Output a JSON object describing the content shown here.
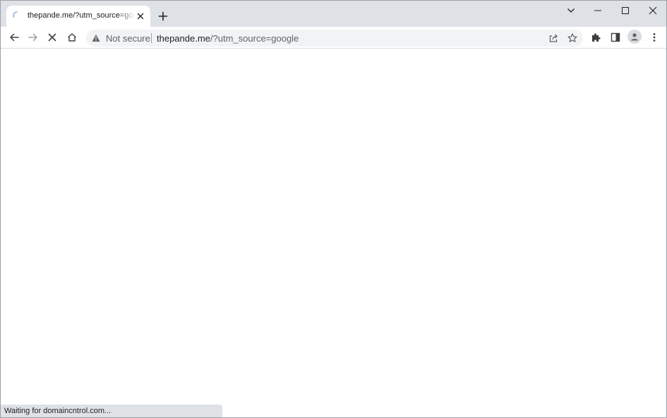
{
  "tab": {
    "title": "thepande.me/?utm_source=google",
    "close_icon": "close-icon",
    "favicon": "loading-spinner-icon"
  },
  "tabstrip": {
    "new_tab_icon": "plus-icon",
    "tab_search_icon": "chevron-down-icon"
  },
  "window_controls": [
    "minimize-icon",
    "maximize-icon",
    "close-icon"
  ],
  "toolbar": {
    "back_icon": "arrow-left-icon",
    "forward_icon": "arrow-right-icon",
    "stop_icon": "stop-x-icon",
    "home_icon": "home-icon"
  },
  "omnibox": {
    "security_label": "Not secure",
    "security_icon": "warning-triangle-icon",
    "url_host": "thepande.me",
    "url_path": "/?utm_source=google",
    "share_icon": "share-icon",
    "bookmark_icon": "star-icon"
  },
  "toolbar_right": {
    "extensions_icon": "puzzle-icon",
    "side_panel_icon": "side-panel-icon",
    "profile_icon": "avatar-icon",
    "menu_icon": "kebab-menu-icon"
  },
  "status_bar": {
    "text": "Waiting for domaincntrol.com..."
  },
  "colors": {
    "tabstrip_bg": "#dee1e6",
    "omnibox_bg": "#f1f3f4",
    "icon": "#5f6368",
    "text": "#202124"
  }
}
